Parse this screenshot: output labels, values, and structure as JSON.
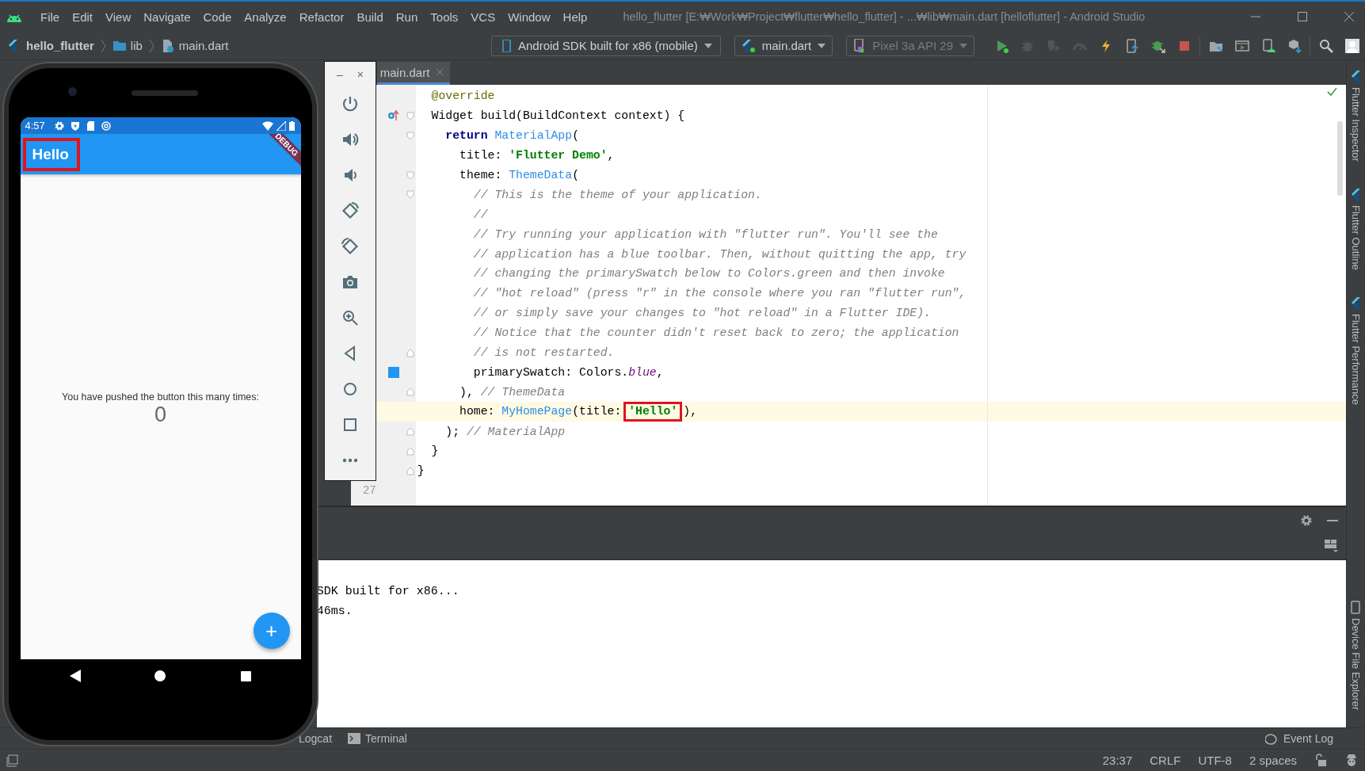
{
  "window": {
    "title": "hello_flutter [E:₩Work₩Project₩flutter₩hello_flutter] - ...₩lib₩main.dart [helloflutter] - Android Studio"
  },
  "menu": [
    "File",
    "Edit",
    "View",
    "Navigate",
    "Code",
    "Analyze",
    "Refactor",
    "Build",
    "Run",
    "Tools",
    "VCS",
    "Window",
    "Help"
  ],
  "breadcrumbs": [
    {
      "label": "hello_flutter",
      "kind": "project"
    },
    {
      "label": "lib",
      "kind": "folder"
    },
    {
      "label": "main.dart",
      "kind": "file"
    }
  ],
  "toolbar": {
    "device_target": "Android SDK built for x86 (mobile)",
    "run_config": "main.dart",
    "device": {
      "label": "Pixel 3a API 29",
      "disabled": true
    },
    "buttons": [
      {
        "kind": "run",
        "disabled": false
      },
      {
        "kind": "debug",
        "disabled": true
      },
      {
        "kind": "profile",
        "disabled": true
      },
      {
        "kind": "gauge",
        "disabled": true
      },
      {
        "kind": "hot-reload",
        "disabled": false
      },
      {
        "kind": "hot-restart",
        "disabled": false
      },
      {
        "kind": "attach",
        "disabled": false
      },
      {
        "kind": "stop",
        "disabled": false
      },
      {
        "kind": "project-structure",
        "disabled": false
      },
      {
        "kind": "avd",
        "disabled": false
      },
      {
        "kind": "device",
        "disabled": false
      },
      {
        "kind": "sdk",
        "disabled": false
      },
      {
        "kind": "search",
        "disabled": false
      },
      {
        "kind": "account",
        "disabled": false
      }
    ]
  },
  "editor": {
    "tabs": [
      {
        "label": "main.dart",
        "selected": true
      }
    ],
    "lines": [
      {
        "current": false,
        "tokens": [
          {
            "kind": "annotation",
            "text": "  @override"
          }
        ]
      },
      {
        "fold_start": true,
        "override_marker": true,
        "current": false,
        "tokens": [
          {
            "kind": "plain",
            "text": "  Widget build(BuildContext context) {"
          }
        ]
      },
      {
        "fold_start": true,
        "current": false,
        "tokens": [
          {
            "kind": "keyword",
            "text": "    return "
          },
          {
            "kind": "class",
            "text": "MaterialApp"
          },
          {
            "kind": "plain",
            "text": "("
          }
        ]
      },
      {
        "current": false,
        "tokens": [
          {
            "kind": "plain",
            "text": "      title: "
          },
          {
            "kind": "string",
            "text": "'Flutter Demo'"
          },
          {
            "kind": "plain",
            "text": ","
          }
        ]
      },
      {
        "fold_start": true,
        "current": false,
        "tokens": [
          {
            "kind": "plain",
            "text": "      theme: "
          },
          {
            "kind": "class",
            "text": "ThemeData"
          },
          {
            "kind": "plain",
            "text": "("
          }
        ]
      },
      {
        "fold_start": true,
        "current": false,
        "tokens": [
          {
            "kind": "comment",
            "text": "        // This is the theme of your application."
          }
        ]
      },
      {
        "current": false,
        "tokens": [
          {
            "kind": "comment",
            "text": "        //"
          }
        ]
      },
      {
        "current": false,
        "tokens": [
          {
            "kind": "comment",
            "text": "        // Try running your application with \"flutter run\". You'll see the"
          }
        ]
      },
      {
        "current": false,
        "tokens": [
          {
            "kind": "comment",
            "text": "        // application has a blue toolbar. Then, without quitting the app, try"
          }
        ]
      },
      {
        "current": false,
        "tokens": [
          {
            "kind": "comment",
            "text": "        // changing the primarySwatch below to Colors.green and then invoke"
          }
        ]
      },
      {
        "current": false,
        "tokens": [
          {
            "kind": "comment",
            "text": "        // \"hot reload\" (press \"r\" in the console where you ran \"flutter run\","
          }
        ]
      },
      {
        "current": false,
        "tokens": [
          {
            "kind": "comment",
            "text": "        // or simply save your changes to \"hot reload\" in a Flutter IDE)."
          }
        ]
      },
      {
        "current": false,
        "tokens": [
          {
            "kind": "comment",
            "text": "        // Notice that the counter didn't reset back to zero; the application"
          }
        ]
      },
      {
        "fold_end": true,
        "current": false,
        "tokens": [
          {
            "kind": "comment",
            "text": "        // is not restarted."
          }
        ]
      },
      {
        "color": "#2196f3",
        "current": false,
        "tokens": [
          {
            "kind": "plain",
            "text": "        primarySwatch: Colors."
          },
          {
            "kind": "field",
            "text": "blue"
          },
          {
            "kind": "plain",
            "text": ","
          }
        ]
      },
      {
        "fold_end": true,
        "current": false,
        "tokens": [
          {
            "kind": "plain",
            "text": "      ), "
          },
          {
            "kind": "comment",
            "text": "// ThemeData"
          }
        ]
      },
      {
        "current": true,
        "tokens": [
          {
            "kind": "plain",
            "text": "      home: "
          },
          {
            "kind": "class",
            "text": "MyHomePage"
          },
          {
            "kind": "plain",
            "text": "(title: "
          },
          {
            "kind": "string",
            "text": "'Hello'",
            "highlighted": true
          },
          {
            "kind": "plain",
            "text": "),"
          }
        ]
      },
      {
        "fold_end": true,
        "current": false,
        "tokens": [
          {
            "kind": "plain",
            "text": "    ); "
          },
          {
            "kind": "comment",
            "text": "// MaterialApp"
          }
        ]
      },
      {
        "fold_end": true,
        "current": false,
        "tokens": [
          {
            "kind": "plain",
            "text": "  }"
          }
        ]
      },
      {
        "fold_end": true,
        "current": false,
        "tokens": [
          {
            "kind": "plain",
            "text": "}"
          }
        ]
      },
      {
        "current": false,
        "number": "27"
      }
    ]
  },
  "emulator": {
    "minimize": "–",
    "close": "×",
    "tools": [
      {
        "kind": "power"
      },
      {
        "kind": "volume-up"
      },
      {
        "kind": "volume-down"
      },
      {
        "kind": "rotate-left"
      },
      {
        "kind": "rotate-right"
      },
      {
        "kind": "camera"
      },
      {
        "kind": "zoom"
      },
      {
        "kind": "back"
      },
      {
        "kind": "home"
      },
      {
        "kind": "overview"
      },
      {
        "kind": "more"
      }
    ]
  },
  "phone": {
    "status_time": "4:57",
    "app_title": "Hello",
    "app_title_highlighted": true,
    "debug_banner": "DEBUG",
    "counter_label": "You have pushed the button this many times:",
    "counter": "0",
    "fab": "+"
  },
  "run_console": {
    "lines": [
      "SDK built for x86...",
      "46ms."
    ]
  },
  "tool_windows": {
    "bottom": [
      {
        "label": "Logcat",
        "kind": "logcat"
      },
      {
        "label": "Terminal",
        "kind": "terminal"
      }
    ],
    "event_log": "Event Log",
    "right": [
      {
        "label": "Flutter Inspector",
        "kind": "flutter"
      },
      {
        "label": "Flutter Outline",
        "kind": "flutter"
      },
      {
        "label": "Flutter Performance",
        "kind": "flutter"
      },
      {
        "label": "Device File Explorer",
        "kind": "device"
      }
    ]
  },
  "status_bar": {
    "position": "23:37",
    "line_separator": "CRLF",
    "encoding": "UTF-8",
    "indent": "2 spaces"
  }
}
